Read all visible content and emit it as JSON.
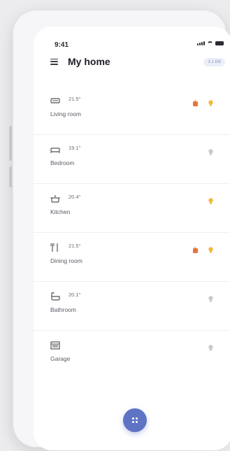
{
  "status": {
    "time": "9:41"
  },
  "header": {
    "title": "My home",
    "badge": "3.1 kW"
  },
  "rooms": [
    {
      "name": "Living room",
      "temp": "21.5°",
      "icon": "sofa-icon",
      "actions": [
        {
          "icon": "heater-icon",
          "state": "on",
          "color": "#e8733a"
        },
        {
          "icon": "bulb-icon",
          "state": "on",
          "color": "#f4b93a"
        }
      ]
    },
    {
      "name": "Bedroom",
      "temp": "19.1°",
      "icon": "bed-icon",
      "actions": [
        {
          "icon": "bulb-icon",
          "state": "off",
          "color": "#c9c9cf"
        }
      ]
    },
    {
      "name": "Kitchen",
      "temp": "20.4°",
      "icon": "pot-icon",
      "actions": [
        {
          "icon": "bulb-icon",
          "state": "on",
          "color": "#f4b93a"
        }
      ]
    },
    {
      "name": "Dining room",
      "temp": "21.5°",
      "icon": "fork-knife-icon",
      "actions": [
        {
          "icon": "heater-icon",
          "state": "on",
          "color": "#e8733a"
        },
        {
          "icon": "bulb-icon",
          "state": "on",
          "color": "#f4b93a"
        }
      ]
    },
    {
      "name": "Bathroom",
      "temp": "20.1°",
      "icon": "bathtub-icon",
      "actions": [
        {
          "icon": "bulb-icon",
          "state": "off",
          "color": "#c9c9cf"
        }
      ]
    },
    {
      "name": "Garage",
      "temp": "",
      "icon": "garage-icon",
      "actions": [
        {
          "icon": "bulb-icon",
          "state": "off",
          "color": "#c9c9cf"
        }
      ]
    }
  ],
  "fab": {
    "icon": "grid-dots-icon"
  },
  "colors": {
    "accent": "#5e73c4",
    "heater": "#e8733a",
    "bulb_on": "#f4b93a",
    "bulb_off": "#c9c9cf"
  }
}
